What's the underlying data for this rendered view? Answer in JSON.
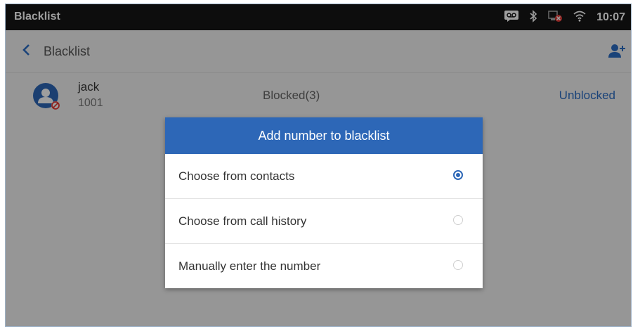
{
  "statusbar": {
    "app_title": "Blacklist",
    "time": "10:07",
    "icons": [
      "voicemail-icon",
      "bluetooth-icon",
      "network-error-icon",
      "wifi-icon"
    ]
  },
  "actionbar": {
    "back_icon": "chevron-left-icon",
    "title": "Blacklist",
    "add_icon": "add-contact-icon"
  },
  "contact_row": {
    "name": "jack",
    "number": "1001",
    "status": "Blocked(3)",
    "action": "Unblocked"
  },
  "dialog": {
    "title": "Add number to blacklist",
    "options": [
      {
        "label": "Choose from contacts",
        "selected": true
      },
      {
        "label": "Choose from call history",
        "selected": false
      },
      {
        "label": "Manually enter the number",
        "selected": false
      }
    ]
  },
  "colors": {
    "accent": "#2d67b7",
    "statusbar_bg": "#161616",
    "link": "#2b6cc4"
  }
}
